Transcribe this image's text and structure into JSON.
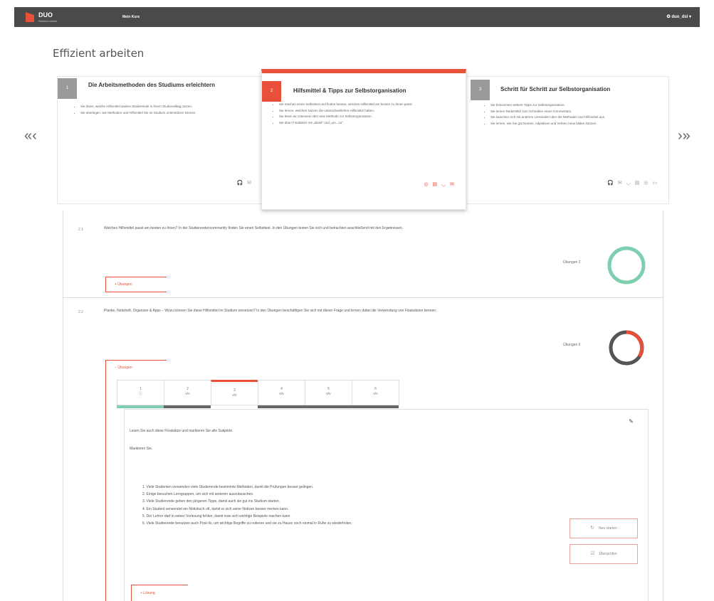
{
  "topbar": {
    "logo": "DUO",
    "logo_sub": "Studium online",
    "nav": "Mein Kurs",
    "user": "✪ duo_dsl ▾"
  },
  "page_title": "Effizient arbeiten",
  "nav_arrows": {
    "prev": "«‹",
    "next": "›»"
  },
  "cards": [
    {
      "num": "1",
      "title": "Die Arbeitsmethoden des Studiums erleichtern",
      "bullets": [
        "Sie lösen, welche Hilfsmittel andere Studierende in ihrem Studienalltag nutzen.",
        "Sie überlegen, wie Methoden und Hilfsmittel Sie im Studium unterstützen können."
      ],
      "icons": "🎧 ✉"
    },
    {
      "num": "2",
      "title": "Hilfsmittel & Tipps zur Selbstorganisation",
      "bullets": [
        "Sie machen einen Selbsttest und finden heraus, welches Hilfsmittel am besten zu Ihnen passt.",
        "Sie lernen, welchen Nutzen die unterschiedlichen Hilfsmittel haben.",
        "Sie lesen ein Interview über eine Methode zur Selbstorganisation.",
        "Sie üben Finalsätze mit „damit“ und „um...zu“."
      ],
      "icons": "◎ ▤ ◡ ✉"
    },
    {
      "num": "3",
      "title": "Schritt für Schritt zur Selbstorganisation",
      "bullets": [
        "Sie bekommen weitere Tipps zur Selbstorganisation.",
        "Sie lernen Redemittel zum Schreiben eines Kommentars.",
        "Sie tauschen sich mit anderen Lernenden über die Methoden und Hilfsmittel aus.",
        "Sie lernen, wie Sie gut Nomen, Adjektiven und Verben neue bilden können."
      ],
      "icons": "🎧 ✉ ◡ ▤ ◎ ▭"
    }
  ],
  "exercises": [
    {
      "num": "2.1",
      "text": "Welches Hilfsmittel passt am besten zu Ihnen? In der Studierendencommunity finden Sie einen Selbsttest. In den Übungen testen Sie sich und betrachten anschließend mit den Ergebnissen.",
      "label": "Übungen 2",
      "button": "+ Übungen"
    },
    {
      "num": "2.2",
      "text": "Planke, Notizheft, Organizer & Apps – Wozu können Sie diese Hilfsmittel im Studium einsetzen? In den Übungen beschäftigen Sie sich mit dieser Frage und lernen dabei die Verwendung von Finalsätzen kennen.",
      "label": "Übungen 6",
      "button": "− Übungen"
    }
  ],
  "tabs": [
    {
      "num": "1",
      "status": "ⓘ"
    },
    {
      "num": "2",
      "status": "v/v"
    },
    {
      "num": "3",
      "status": "v/v"
    },
    {
      "num": "4",
      "status": "v/v"
    },
    {
      "num": "5",
      "status": "v/v"
    },
    {
      "num": "6",
      "status": "v/v"
    }
  ],
  "task": {
    "instruction": "Lesen Sie auch diese Finalsätze und markieren Sie alle Subjekte.",
    "prompt": "Markieren Sie.",
    "sentences": [
      "1. Viele Studenten verwenden viele Studierende bestimmte Methoden, damit die Prüfungen besser gelingen.",
      "2. Einige besuchen Lerngruppen, um sich mit anderen auszutauschen.",
      "3. Viele Studierende geben den jüngeren Tipps, damit auch sie gut ins Studium starten.",
      "4. Ein Student verwendet ein Notizbuch oft, damit er sich seine Notizen besser merken kann.",
      "5. Der Lehrer darf in seiner Vorlesung fehlen, damit man sich wichtige Beispiele machen kann.",
      "6. Viele Studierende benutzen auch Post-Its, um wichtige Begriffe zu notieren und sie zu Hause noch einmal in Ruhe zu wiederholen."
    ]
  },
  "buttons": {
    "restart": "Neu starten",
    "check": "Überprüfen",
    "solution": "+ Lösung"
  },
  "colors": {
    "accent": "#e8503a",
    "progress_green": "#7ecfb0",
    "progress_gray": "#666666",
    "topbar": "#4a4a4a",
    "highlight": "#f5e06a"
  }
}
